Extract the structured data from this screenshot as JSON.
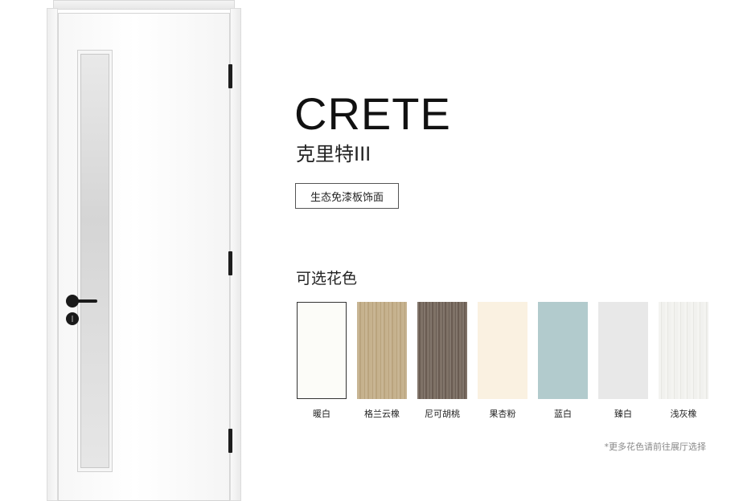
{
  "product": {
    "title": "CRETE",
    "subtitle": "克里特III",
    "material_tag": "生态免漆板饰面"
  },
  "colors": {
    "heading": "可选花色",
    "swatches": [
      {
        "label": "暖白",
        "color": "#fcfcf8",
        "style": "bordered"
      },
      {
        "label": "格兰云橡",
        "color": "#c2ad87",
        "style": "wood-light"
      },
      {
        "label": "尼可胡桃",
        "color": "#786a5f",
        "style": "wood-dark"
      },
      {
        "label": "果杏粉",
        "color": "#faf1e1",
        "style": "plain"
      },
      {
        "label": "蓝白",
        "color": "#b2cbcd",
        "style": "plain"
      },
      {
        "label": "臻白",
        "color": "#e8e8e8",
        "style": "plain"
      },
      {
        "label": "浅灰橡",
        "color": "#eeeeea",
        "style": "wood-pale"
      }
    ]
  },
  "footnote": "*更多花色请前往展厅选择"
}
